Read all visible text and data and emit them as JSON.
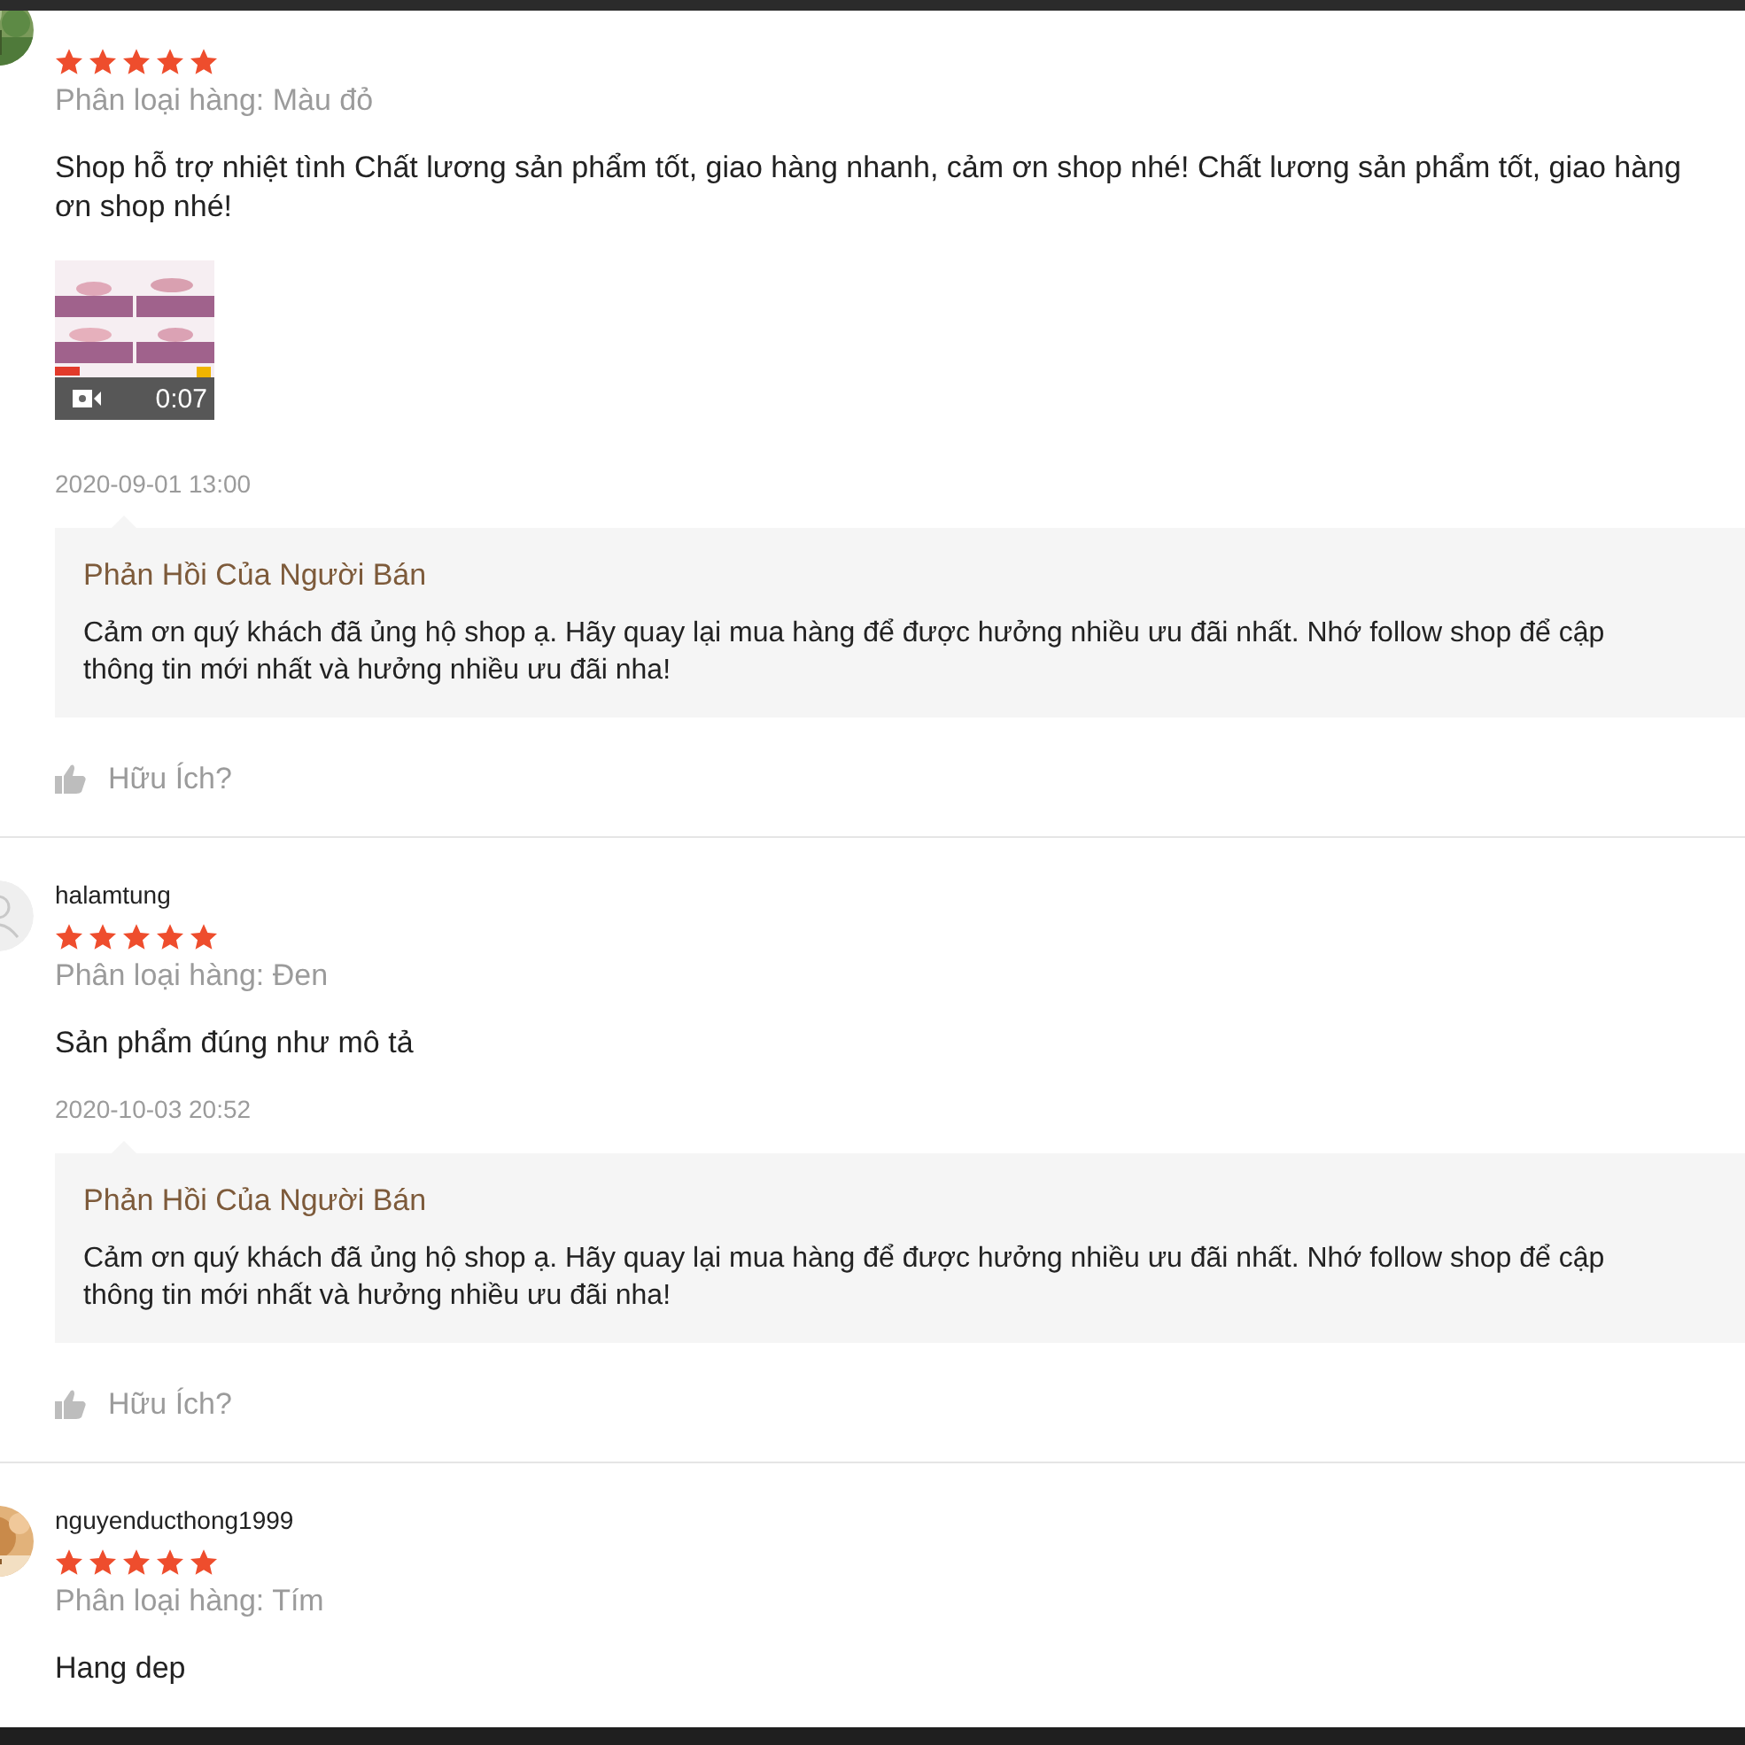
{
  "reviews": [
    {
      "avatar": {
        "kind": "picture"
      },
      "stars": 5,
      "variation": "Phân loại hàng: Màu đỏ",
      "comment_lines": [
        "Shop hỗ trợ nhiệt tình Chất lương sản phẩm tốt, giao hàng nhanh, cảm ơn shop nhé! Chất lương sản phẩm tốt, giao hàng",
        "ơn shop nhé!"
      ],
      "media": [
        {
          "kind": "video",
          "duration": "0:07"
        }
      ],
      "time": "2020-09-01 13:00",
      "seller_reply": {
        "title": "Phản Hồi Của Người Bán",
        "lines": [
          "Cảm ơn quý khách đã ủng hộ shop ạ. Hãy quay lại mua hàng để được hưởng nhiều ưu đãi nhất. Nhớ follow shop để cập",
          "thông tin mới nhất và hưởng nhiều ưu đãi nha!"
        ]
      },
      "helpful": "Hữu Ích?"
    },
    {
      "username": "halamtung",
      "avatar": {
        "kind": "default"
      },
      "stars": 5,
      "variation": "Phân loại hàng: Đen",
      "comment_lines": [
        "Sản phẩm đúng như mô tả"
      ],
      "time": "2020-10-03 20:52",
      "seller_reply": {
        "title": "Phản Hồi Của Người Bán",
        "lines": [
          "Cảm ơn quý khách đã ủng hộ shop ạ. Hãy quay lại mua hàng để được hưởng nhiều ưu đãi nhất. Nhớ follow shop để cập",
          "thông tin mới nhất và hưởng nhiều ưu đãi nha!"
        ]
      },
      "helpful": "Hữu Ích?"
    },
    {
      "username": "nguyenducthong1999",
      "avatar": {
        "kind": "picture"
      },
      "stars": 5,
      "variation": "Phân loại hàng: Tím",
      "comment_lines": [
        "Hang dep"
      ]
    }
  ]
}
